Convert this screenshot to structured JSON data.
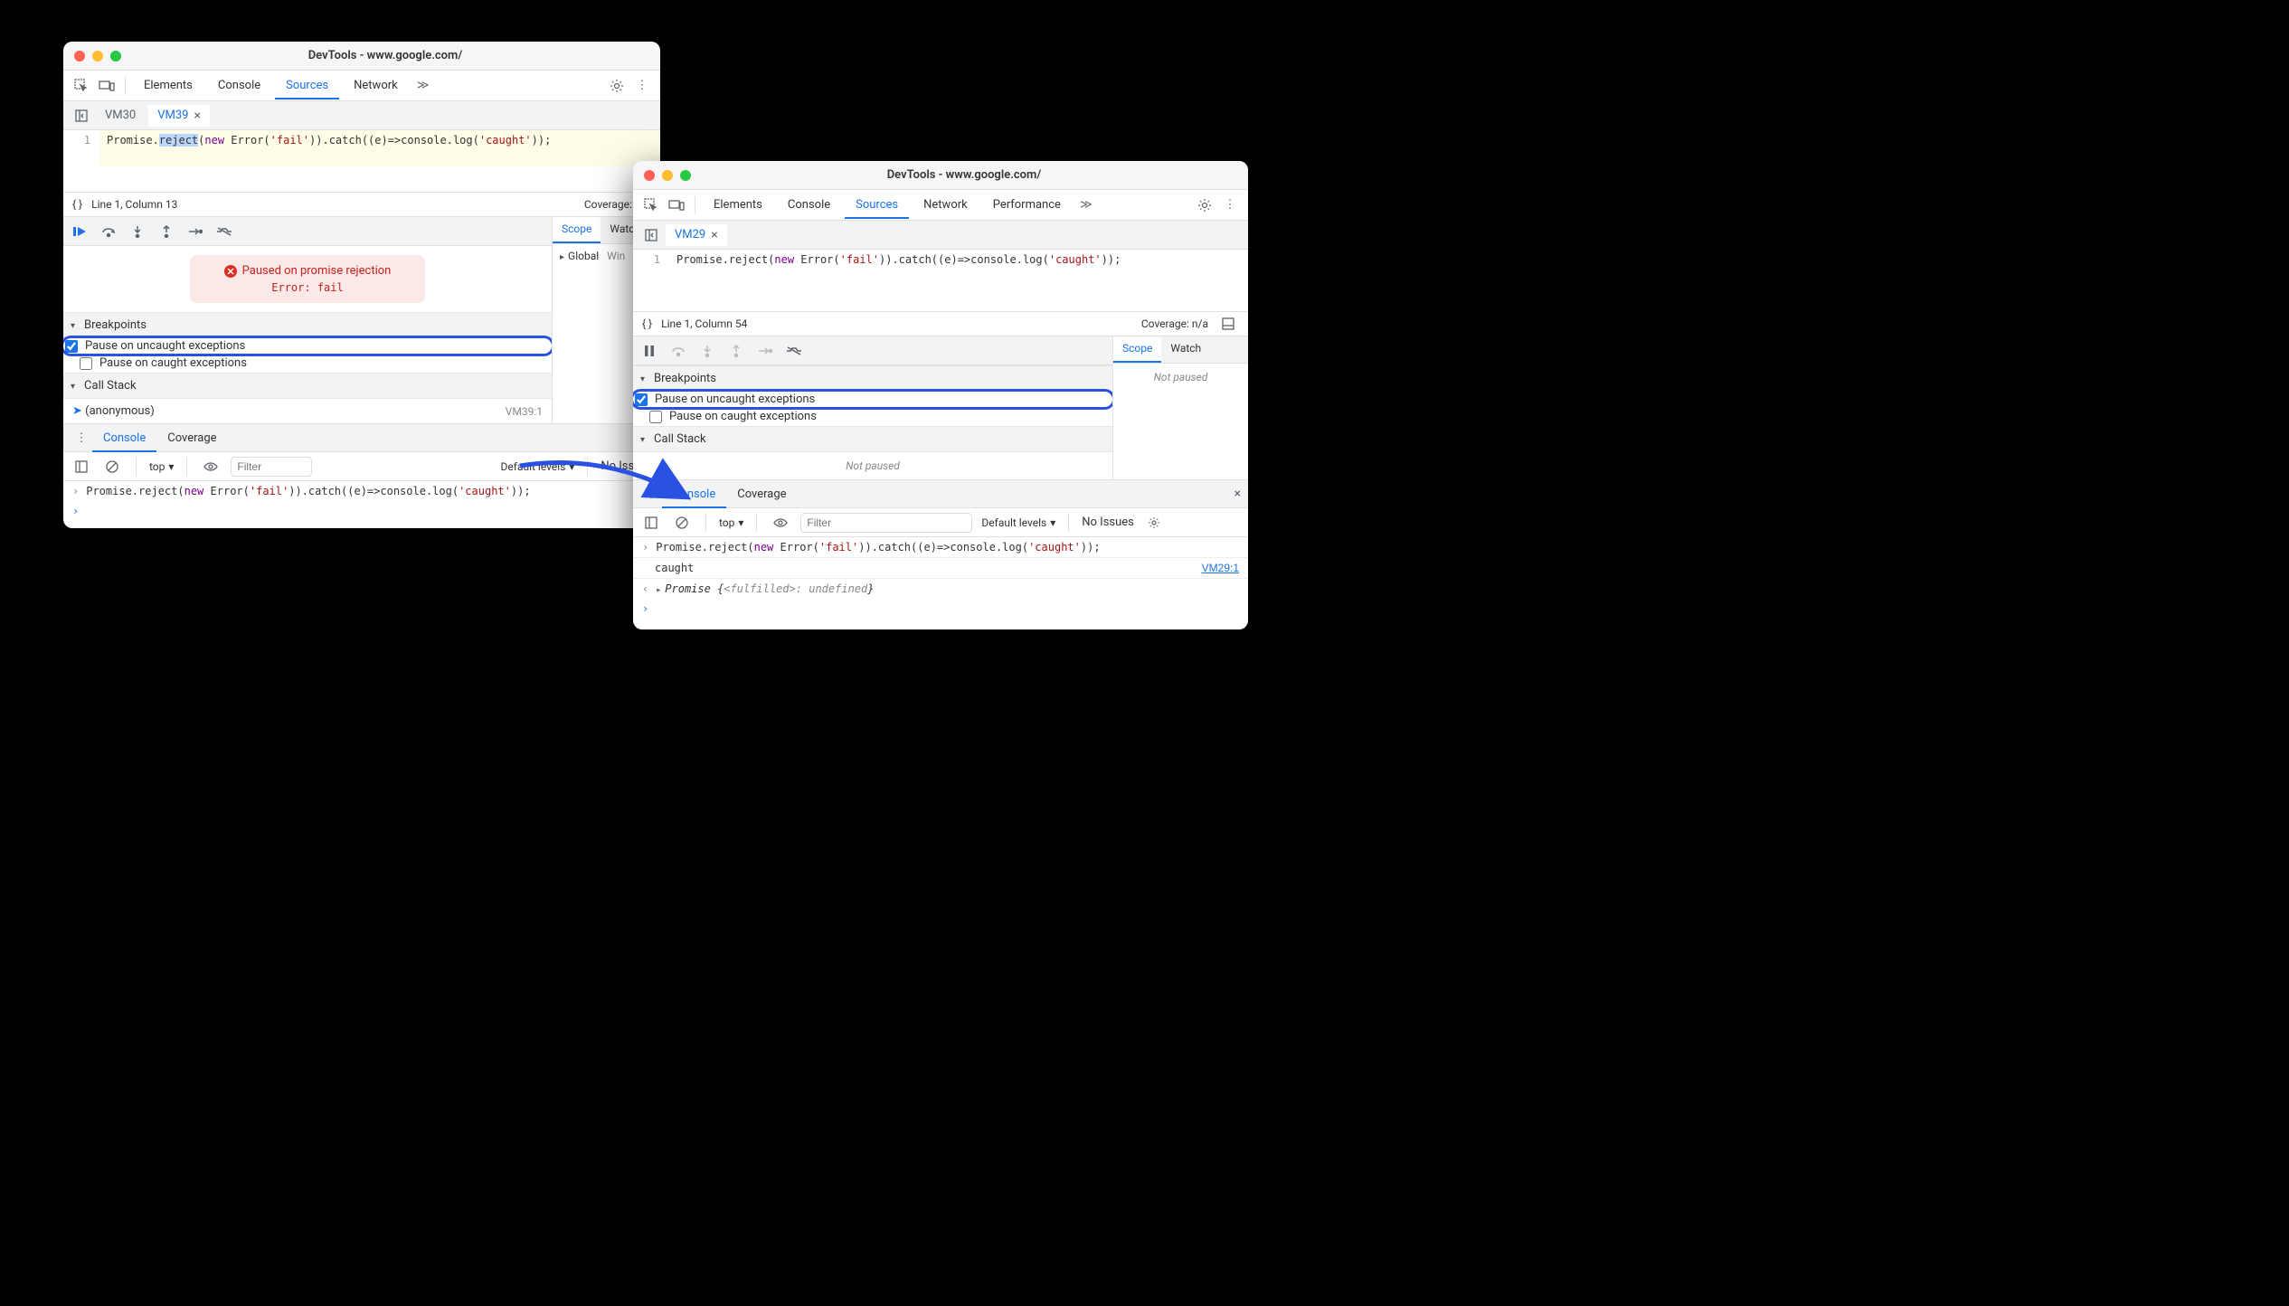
{
  "windows": {
    "left": {
      "title": "DevTools - www.google.com/",
      "tabs": [
        "Elements",
        "Console",
        "Sources",
        "Network"
      ],
      "active_tab": "Sources",
      "file_tabs": [
        {
          "name": "VM30",
          "active": false
        },
        {
          "name": "VM39",
          "active": true
        }
      ],
      "code": {
        "line_no": "1",
        "prefix": "Promise.",
        "selected": "reject",
        "after_sel": "(",
        "kw1": "new",
        "mid1": " Error(",
        "str1": "'fail'",
        "mid2": ")).catch((e)=>console.log(",
        "str2": "'caught'",
        "suffix": "));"
      },
      "status": {
        "pos": "Line 1, Column 13",
        "coverage": "Coverage: n/a"
      },
      "pause": {
        "title": "Paused on promise rejection",
        "sub": "Error: fail"
      },
      "breakpoints": {
        "hdr": "Breakpoints",
        "uncaught": "Pause on uncaught exceptions",
        "caught": "Pause on caught exceptions"
      },
      "callstack": {
        "hdr": "Call Stack",
        "frame": "(anonymous)",
        "src": "VM39:1"
      },
      "scope": {
        "tabs": [
          "Scope",
          "Watch"
        ],
        "global": "Global",
        "win": "Win"
      },
      "drawer": {
        "tabs": [
          "Console",
          "Coverage"
        ]
      },
      "console_bar": {
        "context": "top",
        "filter_ph": "Filter",
        "levels": "Default levels",
        "issues": "No Issues"
      },
      "console": {
        "line1_pre": "Promise.reject(",
        "line1_kw": "new",
        "line1_mid": " Error(",
        "line1_str1": "'fail'",
        "line1_mid2": ")).catch((e)=>console.log(",
        "line1_str2": "'caught'",
        "line1_suf": "));"
      }
    },
    "right": {
      "title": "DevTools - www.google.com/",
      "tabs": [
        "Elements",
        "Console",
        "Sources",
        "Network",
        "Performance"
      ],
      "active_tab": "Sources",
      "file_tabs": [
        {
          "name": "VM29",
          "active": true
        }
      ],
      "code": {
        "line_no": "1",
        "prefix": "Promise.reject(",
        "kw1": "new",
        "mid1": " Error(",
        "str1": "'fail'",
        "mid2": ")).catch((e)=>console.log(",
        "str2": "'caught'",
        "suffix": "));"
      },
      "status": {
        "pos": "Line 1, Column 54",
        "coverage": "Coverage: n/a"
      },
      "breakpoints": {
        "hdr": "Breakpoints",
        "uncaught": "Pause on uncaught exceptions",
        "caught": "Pause on caught exceptions"
      },
      "callstack": {
        "hdr": "Call Stack",
        "not_paused": "Not paused"
      },
      "scope": {
        "tabs": [
          "Scope",
          "Watch"
        ],
        "not_paused": "Not paused"
      },
      "drawer": {
        "tabs": [
          "Console",
          "Coverage"
        ]
      },
      "console_bar": {
        "context": "top",
        "filter_ph": "Filter",
        "levels": "Default levels",
        "issues": "No Issues"
      },
      "console": {
        "line1_pre": "Promise.reject(",
        "line1_kw": "new",
        "line1_mid": " Error(",
        "line1_str1": "'fail'",
        "line1_mid2": ")).catch((e)=>console.log(",
        "line1_str2": "'caught'",
        "line1_suf": "));",
        "line2": "caught",
        "line2_link": "VM29:1",
        "line3_pre": "Promise {",
        "line3_mid": "<fulfilled>: undefined",
        "line3_suf": "}"
      }
    }
  }
}
